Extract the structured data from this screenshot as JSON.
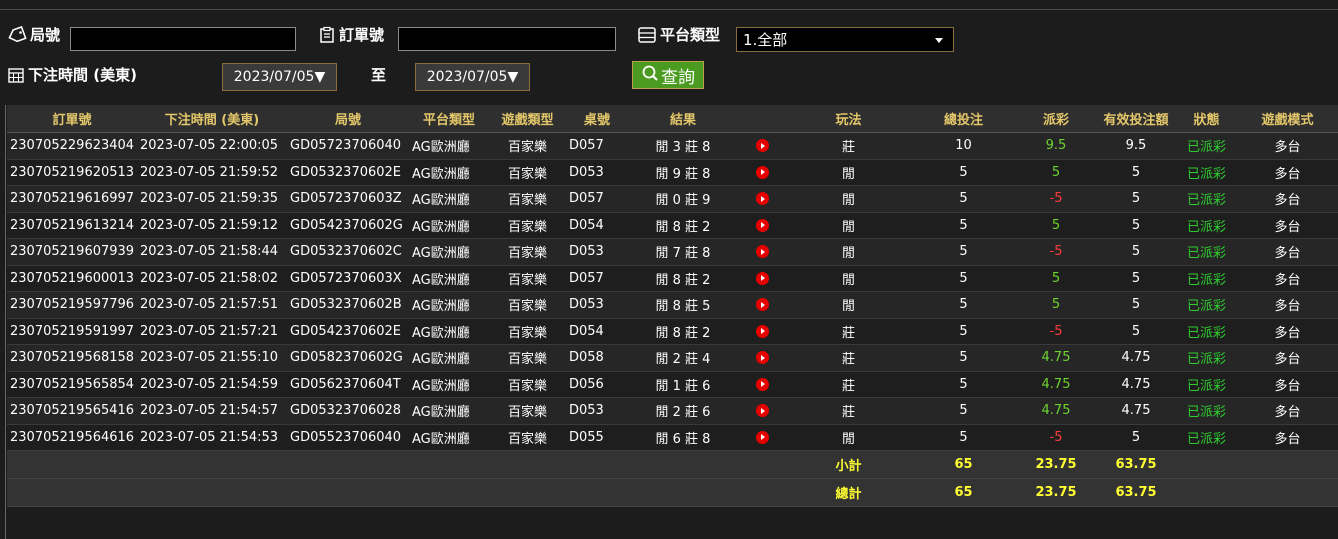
{
  "filters": {
    "bureau_label": "局號",
    "bureau_value": "",
    "order_label": "訂單號",
    "order_value": "",
    "platform_label": "平台類型",
    "platform_selected": "1.全部",
    "bet_time_label": "下注時間 (美東)",
    "date_from": "2023/07/05▼",
    "to_label": "至",
    "date_to": "2023/07/05▼",
    "query_label": "查詢"
  },
  "table": {
    "headers": {
      "order": "訂單號",
      "time": "下注時間 (美東)",
      "bureau": "局號",
      "platform": "平台類型",
      "game_type": "遊戲類型",
      "table_no": "桌號",
      "result": "結果",
      "play": "玩法",
      "total_bet": "總投注",
      "payout": "派彩",
      "valid_bet": "有效投注額",
      "status": "狀態",
      "mode": "遊戲模式"
    },
    "rows": [
      {
        "order": "230705229623404",
        "time": "2023-07-05 22:00:05",
        "bureau": "GD05723706040",
        "platform": "AG歐洲廳",
        "game": "百家樂",
        "table": "D057",
        "result": "閒 3 莊 8",
        "play": "莊",
        "bet": "10",
        "payout": "9.5",
        "payout_type": "win",
        "valid": "9.5",
        "status": "已派彩",
        "mode": "多台"
      },
      {
        "order": "230705219620513",
        "time": "2023-07-05 21:59:52",
        "bureau": "GD0532370602E",
        "platform": "AG歐洲廳",
        "game": "百家樂",
        "table": "D053",
        "result": "閒 9 莊 8",
        "play": "閒",
        "bet": "5",
        "payout": "5",
        "payout_type": "win",
        "valid": "5",
        "status": "已派彩",
        "mode": "多台"
      },
      {
        "order": "230705219616997",
        "time": "2023-07-05 21:59:35",
        "bureau": "GD0572370603Z",
        "platform": "AG歐洲廳",
        "game": "百家樂",
        "table": "D057",
        "result": "閒 0 莊 9",
        "play": "閒",
        "bet": "5",
        "payout": "-5",
        "payout_type": "lose",
        "valid": "5",
        "status": "已派彩",
        "mode": "多台"
      },
      {
        "order": "230705219613214",
        "time": "2023-07-05 21:59:12",
        "bureau": "GD0542370602G",
        "platform": "AG歐洲廳",
        "game": "百家樂",
        "table": "D054",
        "result": "閒 8 莊 2",
        "play": "閒",
        "bet": "5",
        "payout": "5",
        "payout_type": "win",
        "valid": "5",
        "status": "已派彩",
        "mode": "多台"
      },
      {
        "order": "230705219607939",
        "time": "2023-07-05 21:58:44",
        "bureau": "GD0532370602C",
        "platform": "AG歐洲廳",
        "game": "百家樂",
        "table": "D053",
        "result": "閒 7 莊 8",
        "play": "閒",
        "bet": "5",
        "payout": "-5",
        "payout_type": "lose",
        "valid": "5",
        "status": "已派彩",
        "mode": "多台"
      },
      {
        "order": "230705219600013",
        "time": "2023-07-05 21:58:02",
        "bureau": "GD0572370603X",
        "platform": "AG歐洲廳",
        "game": "百家樂",
        "table": "D057",
        "result": "閒 8 莊 2",
        "play": "閒",
        "bet": "5",
        "payout": "5",
        "payout_type": "win",
        "valid": "5",
        "status": "已派彩",
        "mode": "多台"
      },
      {
        "order": "230705219597796",
        "time": "2023-07-05 21:57:51",
        "bureau": "GD0532370602B",
        "platform": "AG歐洲廳",
        "game": "百家樂",
        "table": "D053",
        "result": "閒 8 莊 5",
        "play": "閒",
        "bet": "5",
        "payout": "5",
        "payout_type": "win",
        "valid": "5",
        "status": "已派彩",
        "mode": "多台"
      },
      {
        "order": "230705219591997",
        "time": "2023-07-05 21:57:21",
        "bureau": "GD0542370602E",
        "platform": "AG歐洲廳",
        "game": "百家樂",
        "table": "D054",
        "result": "閒 8 莊 2",
        "play": "莊",
        "bet": "5",
        "payout": "-5",
        "payout_type": "lose",
        "valid": "5",
        "status": "已派彩",
        "mode": "多台"
      },
      {
        "order": "230705219568158",
        "time": "2023-07-05 21:55:10",
        "bureau": "GD0582370602G",
        "platform": "AG歐洲廳",
        "game": "百家樂",
        "table": "D058",
        "result": "閒 2 莊 4",
        "play": "莊",
        "bet": "5",
        "payout": "4.75",
        "payout_type": "win",
        "valid": "4.75",
        "status": "已派彩",
        "mode": "多台"
      },
      {
        "order": "230705219565854",
        "time": "2023-07-05 21:54:59",
        "bureau": "GD0562370604T",
        "platform": "AG歐洲廳",
        "game": "百家樂",
        "table": "D056",
        "result": "閒 1 莊 6",
        "play": "莊",
        "bet": "5",
        "payout": "4.75",
        "payout_type": "win",
        "valid": "4.75",
        "status": "已派彩",
        "mode": "多台"
      },
      {
        "order": "230705219565416",
        "time": "2023-07-05 21:54:57",
        "bureau": "GD05323706028",
        "platform": "AG歐洲廳",
        "game": "百家樂",
        "table": "D053",
        "result": "閒 2 莊 6",
        "play": "莊",
        "bet": "5",
        "payout": "4.75",
        "payout_type": "win",
        "valid": "4.75",
        "status": "已派彩",
        "mode": "多台"
      },
      {
        "order": "230705219564616",
        "time": "2023-07-05 21:54:53",
        "bureau": "GD05523706040",
        "platform": "AG歐洲廳",
        "game": "百家樂",
        "table": "D055",
        "result": "閒 6 莊 8",
        "play": "閒",
        "bet": "5",
        "payout": "-5",
        "payout_type": "lose",
        "valid": "5",
        "status": "已派彩",
        "mode": "多台"
      }
    ],
    "subtotal": {
      "label": "小計",
      "bet": "65",
      "payout": "23.75",
      "valid": "63.75"
    },
    "total": {
      "label": "總計",
      "bet": "65",
      "payout": "23.75",
      "valid": "63.75"
    }
  },
  "colors": {
    "header_text": "#e3c76a",
    "win": "#6cd430",
    "lose": "#ff3b3b",
    "status_paid": "#2ecc2e",
    "totals": "#ffff33",
    "query_button": "#4a9b1f"
  }
}
